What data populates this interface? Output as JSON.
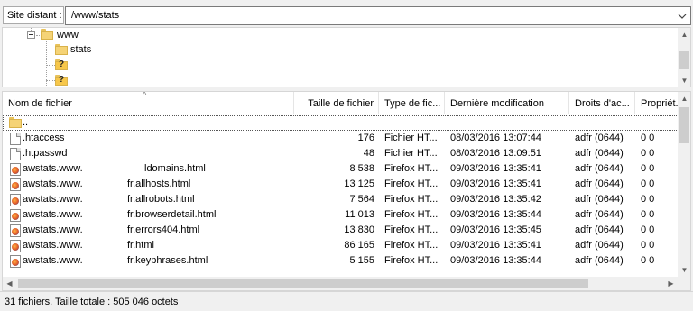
{
  "pathbar": {
    "label": "Site distant :",
    "value": "/www/stats"
  },
  "tree": {
    "items": [
      {
        "label": "www"
      },
      {
        "label": "stats"
      },
      {
        "label": "?"
      },
      {
        "label": "?"
      }
    ]
  },
  "list": {
    "columns": [
      "Nom de fichier",
      "Taille de fichier",
      "Type de fic...",
      "Dernière modification",
      "Droits d'ac...",
      "Propriét..."
    ],
    "parent": "..",
    "rows": [
      {
        "name": ".htaccess",
        "size": "176",
        "type": "Fichier HT...",
        "modified": "08/03/2016 13:07:44",
        "rights": "adfr (0644)",
        "owner": "0 0",
        "icon": "doc"
      },
      {
        "name": ".htpasswd",
        "size": "48",
        "type": "Fichier HT...",
        "modified": "08/03/2016 13:09:51",
        "rights": "adfr (0644)",
        "owner": "0 0",
        "icon": "doc"
      },
      {
        "name_a": "awstats.www.",
        "name_b": "ldomains.html",
        "size": "8 538",
        "type": "Firefox HT...",
        "modified": "09/03/2016 13:35:41",
        "rights": "adfr (0644)",
        "owner": "0 0",
        "icon": "firefox"
      },
      {
        "name_a": "awstats.www.",
        "name_b": "fr.allhosts.html",
        "size": "13 125",
        "type": "Firefox HT...",
        "modified": "09/03/2016 13:35:41",
        "rights": "adfr (0644)",
        "owner": "0 0",
        "icon": "firefox"
      },
      {
        "name_a": "awstats.www.",
        "name_b": "fr.allrobots.html",
        "size": "7 564",
        "type": "Firefox HT...",
        "modified": "09/03/2016 13:35:42",
        "rights": "adfr (0644)",
        "owner": "0 0",
        "icon": "firefox"
      },
      {
        "name_a": "awstats.www.",
        "name_b": "fr.browserdetail.html",
        "size": "11 013",
        "type": "Firefox HT...",
        "modified": "09/03/2016 13:35:44",
        "rights": "adfr (0644)",
        "owner": "0 0",
        "icon": "firefox"
      },
      {
        "name_a": "awstats.www.",
        "name_b": "fr.errors404.html",
        "size": "13 830",
        "type": "Firefox HT...",
        "modified": "09/03/2016 13:35:45",
        "rights": "adfr (0644)",
        "owner": "0 0",
        "icon": "firefox"
      },
      {
        "name_a": "awstats.www.",
        "name_b": "fr.html",
        "size": "86 165",
        "type": "Firefox HT...",
        "modified": "09/03/2016 13:35:41",
        "rights": "adfr (0644)",
        "owner": "0 0",
        "icon": "firefox"
      },
      {
        "name_a": "awstats.www.",
        "name_b": "fr.keyphrases.html",
        "size": "5 155",
        "type": "Firefox HT...",
        "modified": "09/03/2016 13:35:44",
        "rights": "adfr (0644)",
        "owner": "0 0",
        "icon": "firefox"
      }
    ]
  },
  "status": {
    "text": "31 fichiers. Taille totale : 505 046 octets"
  },
  "colors": {
    "folder": "#f5d376",
    "scrollbar_thumb": "#cdcdcd",
    "background": "#f0f0f0"
  }
}
